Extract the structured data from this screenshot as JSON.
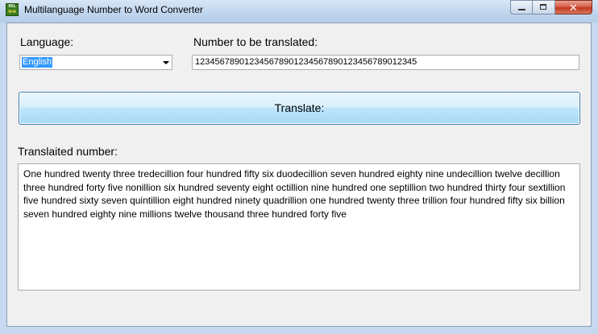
{
  "window": {
    "title": "Multilanguage Number to Word Converter",
    "icon": "hsl-number-icon",
    "icon_text_top": "HSL",
    "icon_text_bottom": "N>W",
    "controls": {
      "minimize": "minimize-icon",
      "maximize": "maximize-icon",
      "close": "close-icon"
    }
  },
  "form": {
    "language_label": "Language:",
    "language_selected": "English",
    "number_label": "Number to be translated:",
    "number_value": "123456789012345678901234567890123456789012345",
    "translate_button": "Translate:",
    "result_label": "Translaited number:",
    "result_text": "One hundred twenty three tredecillion four hundred fifty six duodecillion seven hundred eighty nine undecillion twelve decillion three hundred forty five nonillion six hundred seventy eight octillion nine hundred one septillion two hundred thirty four sextillion five hundred sixty seven quintillion eight hundred ninety quadrillion one hundred twenty three trillion four hundred fifty six billion seven hundred eighty nine millions twelve thousand three hundred forty five"
  },
  "colors": {
    "frame": "#c6d9ee",
    "client": "#f0f0f0",
    "selection": "#3399ff",
    "button_border": "#3c7fb1",
    "close_button": "#c2371f"
  }
}
